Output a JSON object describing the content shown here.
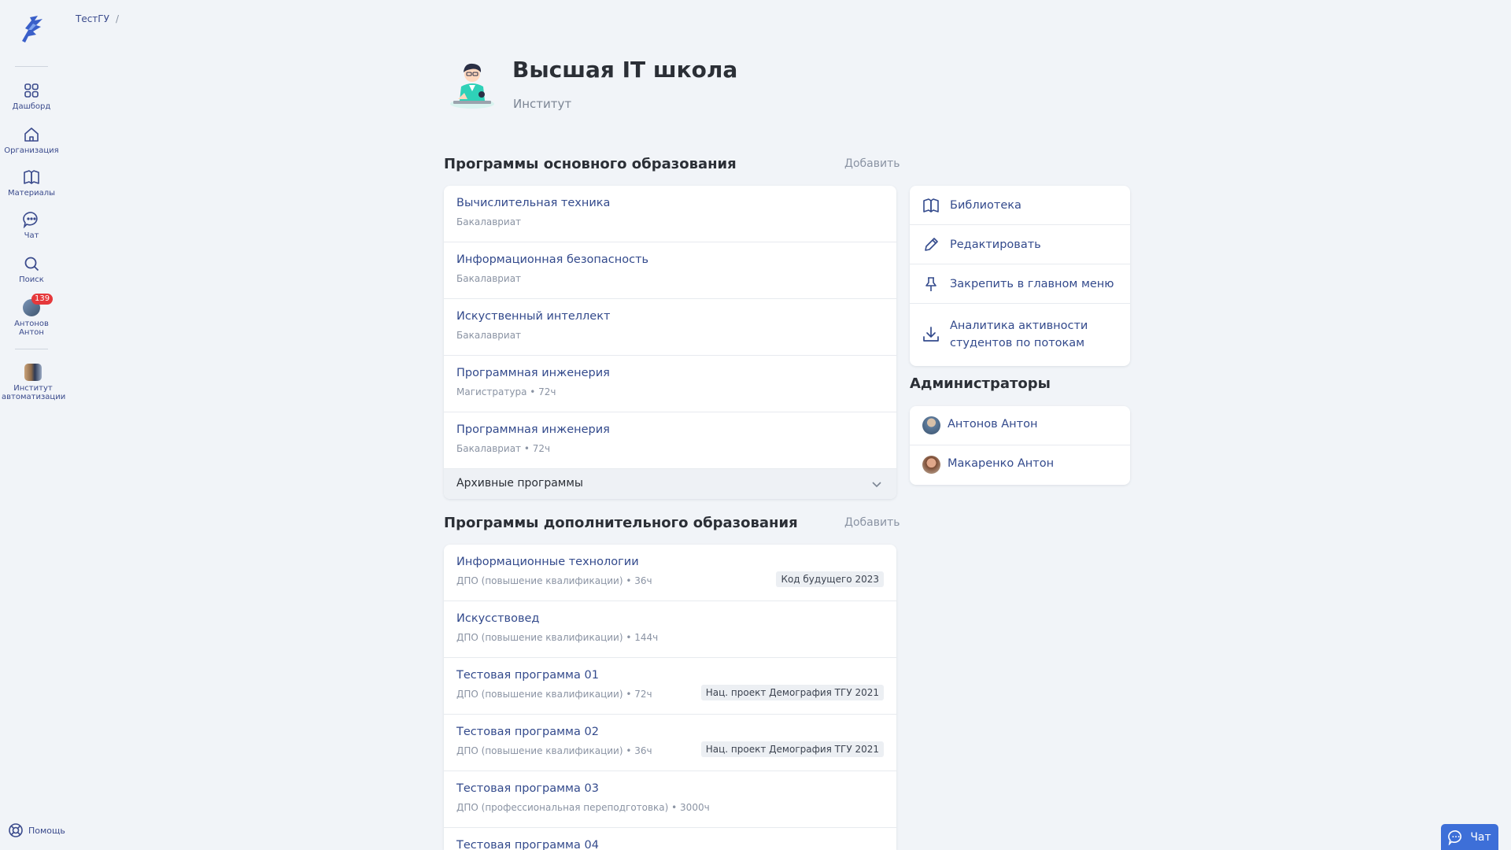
{
  "sidebar": {
    "items": [
      {
        "label": "Дашборд",
        "icon": "dashboard-icon"
      },
      {
        "label": "Организация",
        "icon": "home-icon"
      },
      {
        "label": "Материалы",
        "icon": "book-icon"
      },
      {
        "label": "Чат",
        "icon": "chat-icon"
      },
      {
        "label": "Поиск",
        "icon": "search-icon"
      }
    ],
    "user": {
      "label": "Антонов Антон",
      "badge": "139"
    },
    "institute": {
      "label": "Институт автоматизации"
    },
    "help_label": "Помощь"
  },
  "breadcrumb": {
    "root": "ТестГУ",
    "separator": "/"
  },
  "header": {
    "title": "Высшая IT школа",
    "subtitle": "Институт"
  },
  "main_programs": {
    "title": "Программы основного образования",
    "add_label": "Добавить",
    "items": [
      {
        "title": "Вычислительная техника",
        "sub": "Бакалавриат"
      },
      {
        "title": "Информационная безопасность",
        "sub": "Бакалавриат"
      },
      {
        "title": "Искуственный интеллект",
        "sub": "Бакалавриат"
      },
      {
        "title": "Программная инженерия",
        "sub": "Магистратура • 72ч"
      },
      {
        "title": "Программная инженерия",
        "sub": "Бакалавриат • 72ч"
      }
    ],
    "archive_label": "Архивные программы"
  },
  "extra_programs": {
    "title": "Программы дополнительного образования",
    "add_label": "Добавить",
    "items": [
      {
        "title": "Информационные технологии",
        "sub": "ДПО (повышение квалификации) • 36ч",
        "tag": "Код будущего 2023"
      },
      {
        "title": "Искусствовед",
        "sub": "ДПО (повышение квалификации) • 144ч",
        "tag": ""
      },
      {
        "title": "Тестовая программа 01",
        "sub": "ДПО (повышение квалификации) • 72ч",
        "tag": "Нац. проект Демография ТГУ 2021"
      },
      {
        "title": "Тестовая программа 02",
        "sub": "ДПО (повышение квалификации) • 36ч",
        "tag": "Нац. проект Демография ТГУ 2021"
      },
      {
        "title": "Тестовая программа 03",
        "sub": "ДПО (профессиональная переподготовка) • 3000ч",
        "tag": ""
      },
      {
        "title": "Тестовая программа 04",
        "sub": "",
        "tag": ""
      }
    ]
  },
  "actions": [
    {
      "label": "Библиотека",
      "icon": "book-icon"
    },
    {
      "label": "Редактировать",
      "icon": "pencil-icon"
    },
    {
      "label": "Закрепить в главном меню",
      "icon": "pin-icon"
    },
    {
      "label": "Аналитика активности студентов по потокам",
      "icon": "download-icon"
    }
  ],
  "admins": {
    "title": "Администраторы",
    "items": [
      {
        "name": "Антонов Антон"
      },
      {
        "name": "Макаренко Антон"
      }
    ]
  },
  "chat_button": {
    "label": "Чат",
    "icon": "chat-icon"
  },
  "colors": {
    "accent": "#334a8c",
    "background": "#f1f4f8",
    "chat": "#3d6fd8",
    "badge": "#e5383b"
  }
}
